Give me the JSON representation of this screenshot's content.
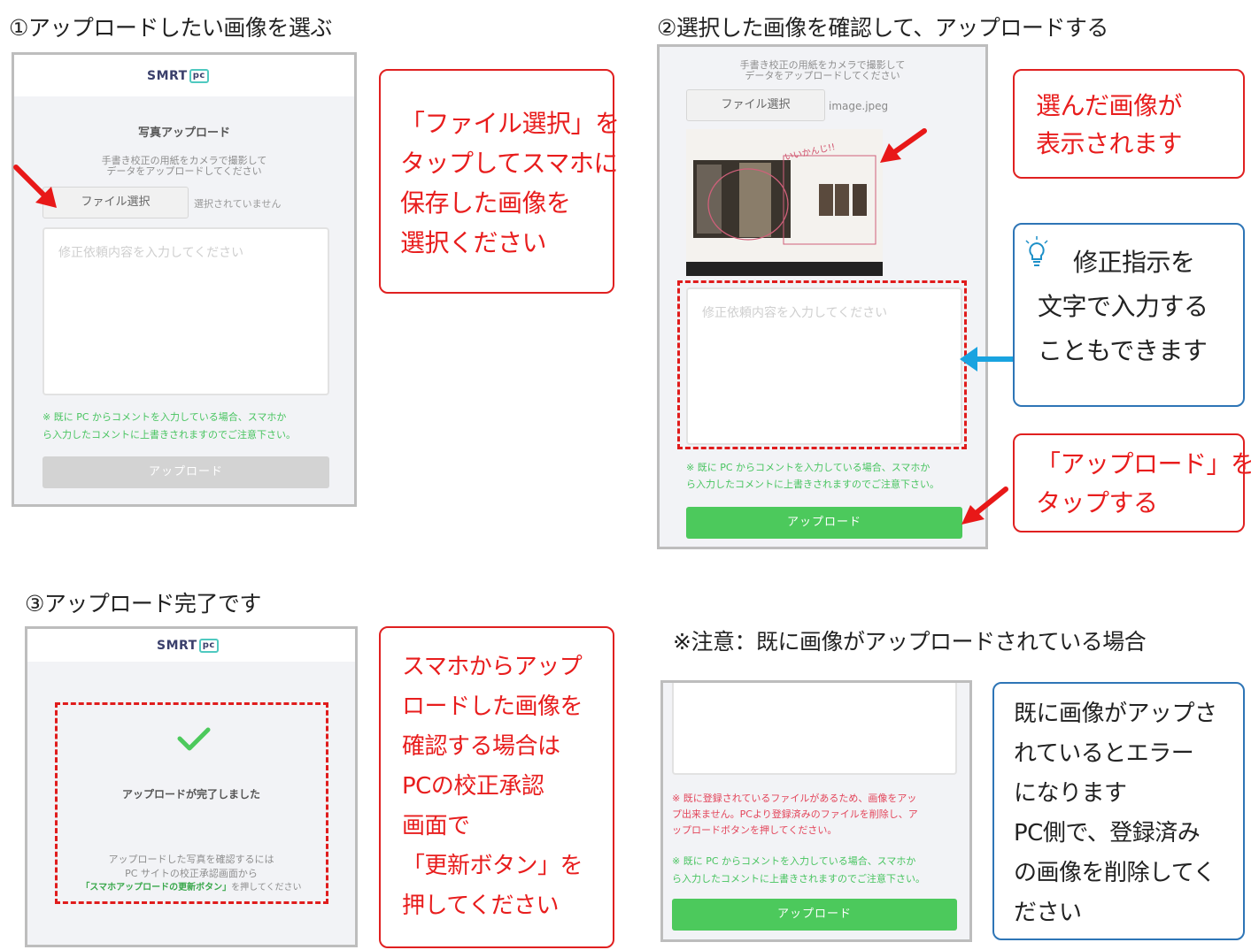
{
  "step1": {
    "title": "①アップロードしたい画像を選ぶ",
    "screen": {
      "logo": "SMRT",
      "logo_badge": "pc",
      "heading": "写真アップロード",
      "instruction_line1": "手書き校正の用紙をカメラで撮影して",
      "instruction_line2": "データをアップロードしてください",
      "file_button": "ファイル選択",
      "file_status": "選択されていません",
      "textarea_placeholder": "修正依頼内容を入力してください",
      "note_line1": "※ 既に PC からコメントを入力している場合、スマホか",
      "note_line2": "ら入力したコメントに上書きされますのでご注意下さい。",
      "upload_button": "アップロード"
    },
    "callout": [
      "「ファイル選択」を",
      "タップしてスマホに",
      "保存した画像を",
      "選択ください"
    ]
  },
  "step2": {
    "title": "②選択した画像を確認して、アップロードする",
    "screen": {
      "instruction_line1": "手書き校正の用紙をカメラで撮影して",
      "instruction_line2": "データをアップロードしてください",
      "file_button": "ファイル選択",
      "file_name": "image.jpeg",
      "photo_caption": "いいかんじ!!",
      "textarea_placeholder": "修正依頼内容を入力してください",
      "note_line1": "※ 既に PC からコメントを入力している場合、スマホか",
      "note_line2": "ら入力したコメントに上書きされますのでご注意下さい。",
      "upload_button": "アップロード"
    },
    "callout_selected": [
      "選んだ画像が",
      "表示されます"
    ],
    "callout_tip": [
      "修正指示を",
      "文字で入力する",
      "こともできます"
    ],
    "callout_tap": [
      "「アップロード」を",
      "タップする"
    ]
  },
  "step3": {
    "title": "③アップロード完了です",
    "screen": {
      "logo": "SMRT",
      "logo_badge": "pc",
      "done_text": "アップロードが完了しました",
      "info_line1": "アップロードした写真を確認するには",
      "info_line2": "PC サイトの校正承認画面から",
      "info_highlight": "「スマホアップロードの更新ボタン」",
      "info_line3_suffix": "を押してください"
    },
    "callout": [
      "スマホからアップ",
      "ロードした画像を",
      "確認する場合は",
      "PCの校正承認",
      "画面で",
      "「更新ボタン」を",
      "押してください"
    ]
  },
  "warning": {
    "title": "※注意：既に画像がアップロードされている場合",
    "screen": {
      "error_line1": "※ 既に登録されているファイルがあるため、画像をアッ",
      "error_line2": "プ出来ません。PCより登録済みのファイルを削除し、ア",
      "error_line3": "ップロードボタンを押してください。",
      "note_line1": "※ 既に PC からコメントを入力している場合、スマホか",
      "note_line2": "ら入力したコメントに上書きされますのでご注意下さい。",
      "upload_button": "アップロード"
    },
    "callout": [
      "既に画像がアップさ",
      "れているとエラー",
      "になります",
      "PC側で、登録済み",
      "の画像を削除してく",
      "ださい"
    ]
  },
  "colors": {
    "callout_red": "#e02020",
    "callout_blue": "#2e75b6",
    "upload_green": "#4cc95c",
    "upload_disabled": "#d3d3d3",
    "arrow_blue": "#19a3e0",
    "note_green": "#48c460",
    "error_red": "#e3455a"
  }
}
